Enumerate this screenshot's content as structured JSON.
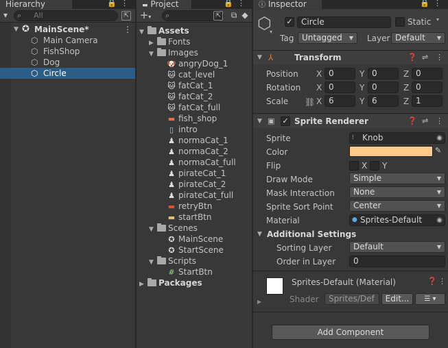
{
  "hierarchy": {
    "tab_title": "Hierarchy",
    "search_placeholder": "All",
    "scene": "MainScene*",
    "objects": [
      "Main Camera",
      "FishShop",
      "Dog",
      "Circle"
    ],
    "selected": "Circle"
  },
  "project": {
    "tab_title": "Project",
    "add_label": "+",
    "tree": [
      {
        "label": "Assets",
        "kind": "folder-open",
        "depth": 0,
        "bold": true
      },
      {
        "label": "Fonts",
        "kind": "folder",
        "depth": 1
      },
      {
        "label": "Images",
        "kind": "folder-open",
        "depth": 1
      },
      {
        "label": "angryDog_1",
        "kind": "sprite-dog",
        "depth": 2
      },
      {
        "label": "cat_level",
        "kind": "sprite-cat",
        "depth": 2
      },
      {
        "label": "fatCat_1",
        "kind": "sprite-cat",
        "depth": 2
      },
      {
        "label": "fatCat_2",
        "kind": "sprite-cat",
        "depth": 2
      },
      {
        "label": "fatCat_full",
        "kind": "sprite-cat",
        "depth": 2
      },
      {
        "label": "fish_shop",
        "kind": "sprite-shop",
        "depth": 2
      },
      {
        "label": "intro",
        "kind": "sprite-intro",
        "depth": 2
      },
      {
        "label": "normaCat_1",
        "kind": "sprite-small",
        "depth": 2
      },
      {
        "label": "normaCat_2",
        "kind": "sprite-small",
        "depth": 2
      },
      {
        "label": "normaCat_full",
        "kind": "sprite-small",
        "depth": 2
      },
      {
        "label": "pirateCat_1",
        "kind": "sprite-small",
        "depth": 2
      },
      {
        "label": "pirateCat_2",
        "kind": "sprite-small",
        "depth": 2
      },
      {
        "label": "pirateCat_full",
        "kind": "sprite-small",
        "depth": 2
      },
      {
        "label": "retryBtn",
        "kind": "sprite-btn",
        "depth": 2
      },
      {
        "label": "startBtn",
        "kind": "sprite-start",
        "depth": 2
      },
      {
        "label": "Scenes",
        "kind": "folder-open",
        "depth": 1
      },
      {
        "label": "MainScene",
        "kind": "scene",
        "depth": 2
      },
      {
        "label": "StartScene",
        "kind": "scene",
        "depth": 2
      },
      {
        "label": "Scripts",
        "kind": "folder-open",
        "depth": 1
      },
      {
        "label": "StartBtn",
        "kind": "script",
        "depth": 2
      },
      {
        "label": "Packages",
        "kind": "folder",
        "depth": 0,
        "bold": true
      }
    ]
  },
  "inspector": {
    "tab_title": "Inspector",
    "object_name": "Circle",
    "static_label": "Static",
    "tag_label": "Tag",
    "tag_value": "Untagged",
    "layer_label": "Layer",
    "layer_value": "Default",
    "transform": {
      "title": "Transform",
      "position_label": "Position",
      "rotation_label": "Rotation",
      "scale_label": "Scale",
      "position": [
        "0",
        "0",
        "0"
      ],
      "rotation": [
        "0",
        "0",
        "0"
      ],
      "scale": [
        "6",
        "6",
        "1"
      ],
      "axes": [
        "X",
        "Y",
        "Z"
      ]
    },
    "sprite_renderer": {
      "title": "Sprite Renderer",
      "sprite_label": "Sprite",
      "sprite_value": "Knob",
      "color_label": "Color",
      "color_value": "#ffc98a",
      "flip_label": "Flip",
      "flip_x": "X",
      "flip_y": "Y",
      "draw_mode_label": "Draw Mode",
      "draw_mode_value": "Simple",
      "mask_label": "Mask Interaction",
      "mask_value": "None",
      "sort_point_label": "Sprite Sort Point",
      "sort_point_value": "Center",
      "material_label": "Material",
      "material_value": "Sprites-Default",
      "additional_label": "Additional Settings",
      "sorting_layer_label": "Sorting Layer",
      "sorting_layer_value": "Default",
      "order_label": "Order in Layer",
      "order_value": "0"
    },
    "material": {
      "title": "Sprites-Default (Material)",
      "shader_label": "Shader",
      "shader_value": "Sprites/Def",
      "edit_label": "Edit..."
    },
    "add_component_label": "Add Component"
  },
  "colors": {
    "selection": "#2c5d87",
    "panel": "#383838",
    "tint": "#ffc98a"
  }
}
